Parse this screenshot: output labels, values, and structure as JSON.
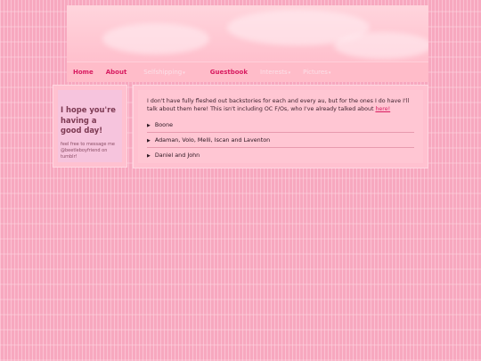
{
  "nav": {
    "items": [
      {
        "label": "Home",
        "state": "active"
      },
      {
        "label": "About",
        "state": "active"
      },
      {
        "label": "Selfshipping",
        "state": "muted",
        "caret": "▾"
      },
      {
        "label": "Guestbook",
        "state": "active"
      },
      {
        "label": "Interests",
        "state": "muted",
        "caret": "▾"
      },
      {
        "label": "Pictures",
        "state": "muted",
        "caret": "▾"
      }
    ]
  },
  "sidebar": {
    "greeting": "I hope you're having a good day!",
    "note": "feel free to message me @beetleboyfriend on tumblr!"
  },
  "main": {
    "intro": "I don't have fully fleshed out backstories for each and every au, but for the ones I do have I'll talk about them here! This isn't including OC F/Os, who I've already talked about ",
    "intro_link": "here!",
    "sections": [
      {
        "label": "Boone"
      },
      {
        "label": "Adaman, Volo, Melli, Iscan and Laventon"
      },
      {
        "label": "Daniel and John"
      }
    ]
  },
  "colors": {
    "accent": "#d81b60",
    "background": "#f7a8bf",
    "panel": "#ffc1d0"
  }
}
